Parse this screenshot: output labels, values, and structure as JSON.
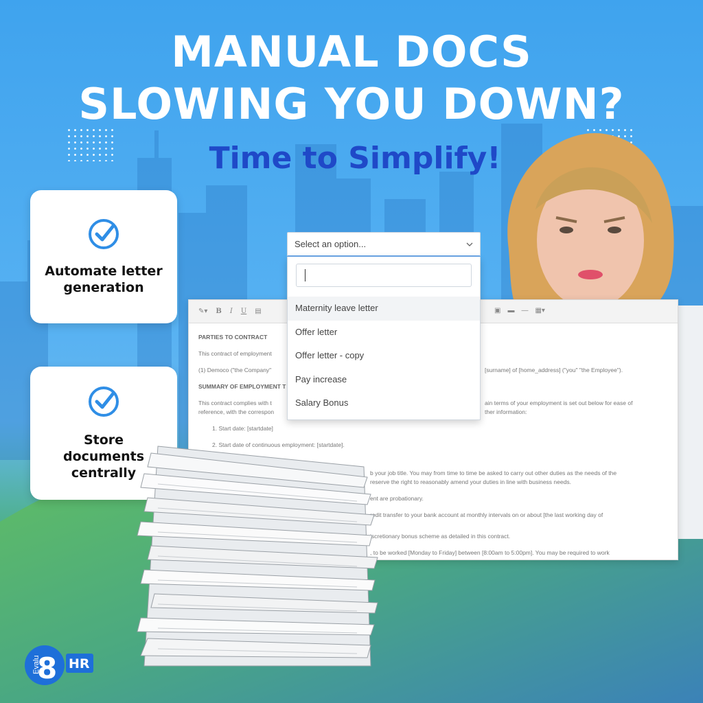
{
  "headline": {
    "line1": "MANUAL DOCS",
    "line2": "SLOWING YOU DOWN?"
  },
  "subheadline": "Time to Simplify!",
  "features": [
    {
      "icon": "check-circle-icon",
      "line1": "Automate letter",
      "line2": "generation",
      "line3": ""
    },
    {
      "icon": "check-circle-icon",
      "line1": "Store",
      "line2": "documents",
      "line3": "centrally"
    }
  ],
  "dropdown": {
    "placeholder": "Select an option...",
    "search_value": "",
    "options": [
      {
        "label": "Maternity leave letter",
        "highlighted": true
      },
      {
        "label": "Offer letter",
        "highlighted": false
      },
      {
        "label": "Offer letter - copy",
        "highlighted": false
      },
      {
        "label": "Pay increase",
        "highlighted": false
      },
      {
        "label": "Salary Bonus",
        "highlighted": false
      }
    ]
  },
  "document": {
    "toolbar": [
      "B",
      "I",
      "U"
    ],
    "lines": [
      "PARTIES TO CONTRACT",
      "This contract of employment",
      "(1) Democo (\"the Company\"",
      "[surname] of [home_address] (\"you\" \"the Employee\").",
      "SUMMARY OF EMPLOYMENT T",
      "This contract complies with t",
      "ain terms of your employment is set out below for ease of",
      "reference, with the correspon",
      "ther information:",
      "1.   Start date: [startdate]",
      "2.   Start date of continuous employment: [startdate].",
      "b your job title.  You may from time to time be asked to carry out other duties as the needs of the",
      "reserve the right to reasonably amend your duties in line with business needs.",
      "ent are probationary.",
      "redit transfer to your bank account at monthly intervals on or about [the last working day of",
      "iscretionary bonus scheme as detailed in this contract.",
      ", to be worked [Monday to Friday] between [8:00am to 5:00pm]. You may be required to work"
    ]
  },
  "brand": {
    "logo_prefix": "Evalu",
    "logo_number": "8",
    "logo_suffix": "HR"
  },
  "colors": {
    "headline": "#ffffff",
    "subheadline": "#1f49c8",
    "check": "#2f8ee6",
    "dropdown_focus": "#6aa6e8",
    "logo_blue": "#1e6fd9"
  }
}
